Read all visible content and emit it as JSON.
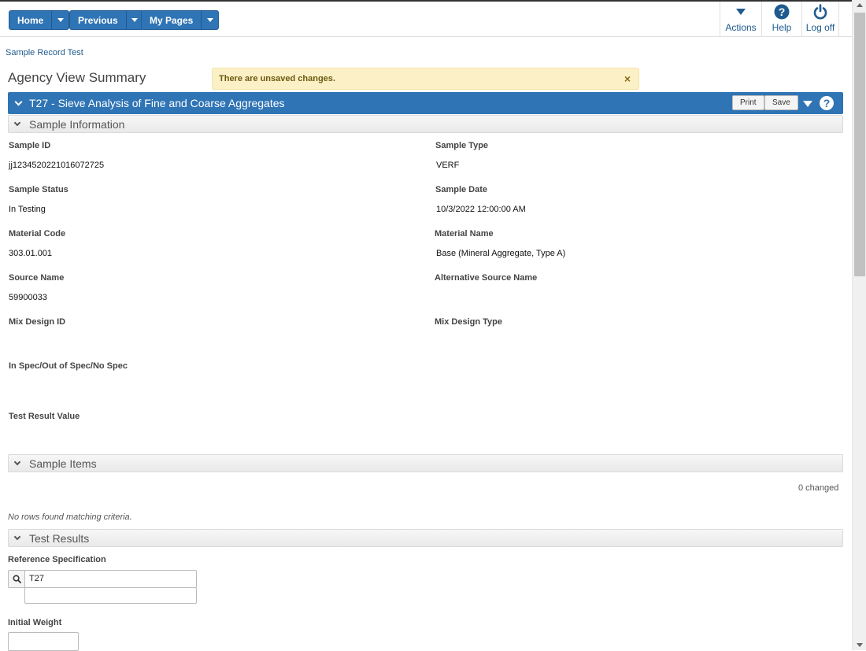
{
  "nav": {
    "home": "Home",
    "previous": "Previous",
    "my_pages": "My Pages"
  },
  "tools": {
    "actions": "Actions",
    "help": "Help",
    "logoff": "Log off"
  },
  "breadcrumb": "Sample Record Test",
  "page_title": "Agency View Summary",
  "alert": {
    "text": "There are unsaved changes.",
    "close": "×"
  },
  "record": {
    "title": "T27 - Sieve Analysis of Fine and Coarse Aggregates",
    "print": "Print",
    "save": "Save"
  },
  "sections": {
    "sample_info": "Sample Information",
    "sample_items": "Sample Items",
    "test_results": "Test Results"
  },
  "fields": {
    "sample_id": {
      "label": "Sample ID",
      "value": "jj1234520221016072725"
    },
    "sample_type": {
      "label": "Sample Type",
      "value": "VERF"
    },
    "sample_status": {
      "label": "Sample Status",
      "value": "In Testing"
    },
    "sample_date": {
      "label": "Sample Date",
      "value": "10/3/2022 12:00:00 AM"
    },
    "material_code": {
      "label": "Material Code",
      "value": "303.01.001"
    },
    "material_name": {
      "label": "Material Name",
      "value": "Base (Mineral Aggregate, Type A)"
    },
    "source_name": {
      "label": "Source Name",
      "value": "59900033"
    },
    "alt_source_name": {
      "label": "Alternative Source Name",
      "value": ""
    },
    "mix_design_id": {
      "label": "Mix Design ID",
      "value": ""
    },
    "mix_design_type": {
      "label": "Mix Design Type",
      "value": ""
    },
    "in_spec": {
      "label": "In Spec/Out of Spec/No Spec",
      "value": ""
    },
    "test_result_value": {
      "label": "Test Result Value",
      "value": ""
    }
  },
  "sample_items": {
    "changed": "0 changed",
    "empty": "No rows found matching criteria."
  },
  "test_results": {
    "ref_spec_label": "Reference Specification",
    "ref_spec_value": "T27",
    "ref_spec_desc": "",
    "initial_weight_label": "Initial Weight",
    "initial_weight_value": ""
  }
}
